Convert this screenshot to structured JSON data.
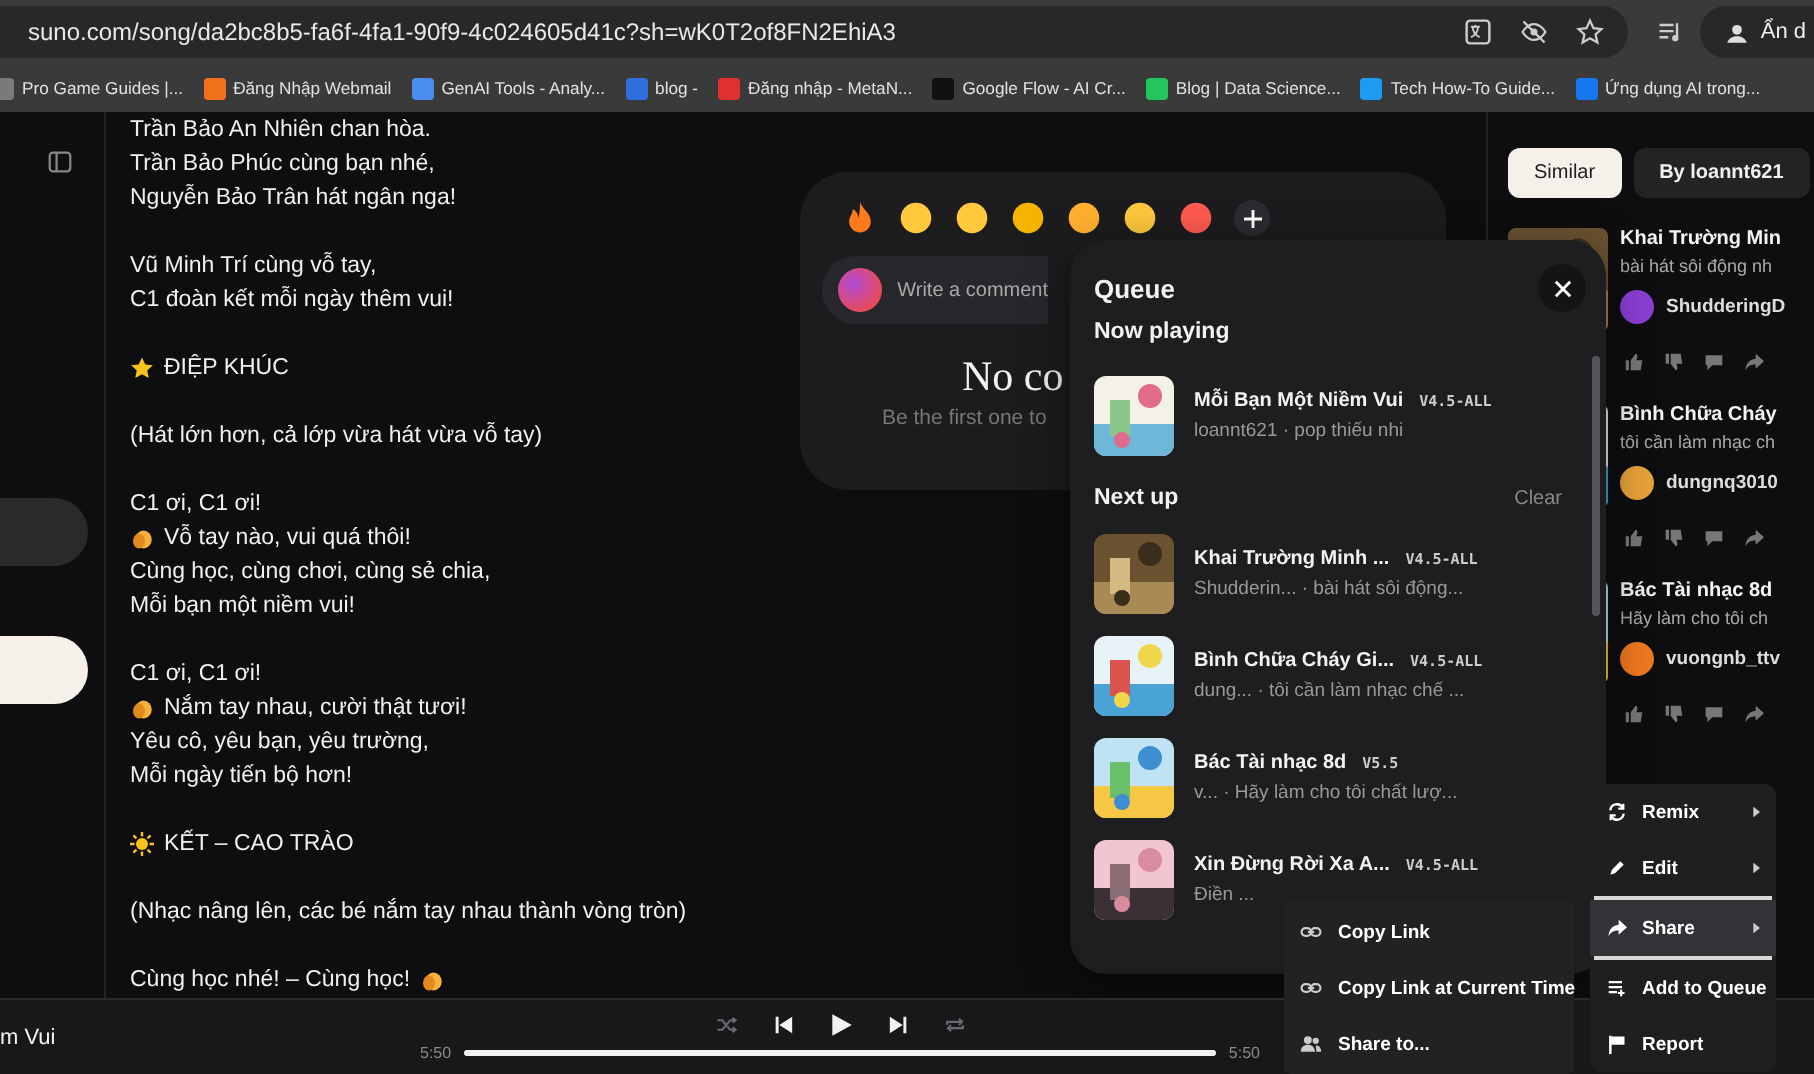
{
  "browser": {
    "url": "suno.com/song/da2bc8b5-fa6f-4fa1-90f9-4c024605d41c?sh=wK0T2of8FN2EhiA3",
    "profile": "Ẩn d"
  },
  "bookmarks": [
    {
      "label": "Pro Game Guides |...",
      "color": "#7a7a7a"
    },
    {
      "label": "Đăng Nhập Webmail",
      "color": "#f2711c"
    },
    {
      "label": "GenAI Tools - Analy...",
      "color": "#4a8df0"
    },
    {
      "label": "blog -",
      "color": "#2f6fe0"
    },
    {
      "label": "Đăng nhập - MetaN...",
      "color": "#e03131"
    },
    {
      "label": "Google Flow - AI Cr...",
      "color": "#111111"
    },
    {
      "label": "Blog | Data Science...",
      "color": "#22c55e"
    },
    {
      "label": "Tech How-To Guide...",
      "color": "#1d9bf0"
    },
    {
      "label": "Ứng dụng AI trong...",
      "color": "#1877f2"
    }
  ],
  "lyrics": [
    [
      {
        "text": "Trần Bảo An Nhiên chan hòa.",
        "kind": "plain"
      },
      {
        "text": "Trần Bảo Phúc cùng bạn nhé,",
        "kind": "plain"
      },
      {
        "text": "Nguyễn Bảo Trân hát ngân nga!",
        "kind": "plain"
      }
    ],
    [
      {
        "text": "Vũ Minh Trí cùng vỗ tay,",
        "kind": "plain"
      },
      {
        "text": "C1 đoàn kết mỗi ngày thêm vui!",
        "kind": "plain"
      }
    ],
    [
      {
        "text": "ĐIỆP KHÚC",
        "kind": "star"
      }
    ],
    [
      {
        "text": "(Hát lớn hơn, cả lớp vừa hát vừa vỗ tay)",
        "kind": "plain"
      }
    ],
    [
      {
        "text": "C1 ơi, C1 ơi!",
        "kind": "plain"
      },
      {
        "text": "Vỗ tay nào, vui quá thôi!",
        "kind": "clap"
      },
      {
        "text": "Cùng học, cùng chơi, cùng sẻ chia,",
        "kind": "plain"
      },
      {
        "text": "Mỗi bạn một niềm vui!",
        "kind": "plain"
      }
    ],
    [
      {
        "text": "C1 ơi, C1 ơi!",
        "kind": "plain"
      },
      {
        "text": "Nắm tay nhau, cười thật tươi!",
        "kind": "clap"
      },
      {
        "text": "Yêu cô, yêu bạn, yêu trường,",
        "kind": "plain"
      },
      {
        "text": "Mỗi ngày tiến bộ hơn!",
        "kind": "plain"
      }
    ],
    [
      {
        "text": "KẾT – CAO TRÀO",
        "kind": "sun"
      }
    ],
    [
      {
        "text": "(Nhạc nâng lên, các bé nắm tay nhau thành vòng tròn)",
        "kind": "plain"
      }
    ],
    [
      {
        "text": "Cùng học nhé! – Cùng học!",
        "kind": "clap-after"
      }
    ]
  ],
  "comments": {
    "placeholder": "Write a comment",
    "empty_title": "No co",
    "empty_hint": "Be the first one to"
  },
  "tabs": [
    {
      "label": "Similar",
      "selected": true
    },
    {
      "label": "By loannt621",
      "selected": false
    }
  ],
  "similar": [
    {
      "title": "Khai Trường Min",
      "description": "bài hát sôi động nh",
      "author": "ShudderingD",
      "color": "#8b3fd6"
    },
    {
      "title": "Bình Chữa Cháy",
      "description": "tôi cần làm nhạc ch",
      "author": "dungnq3010",
      "color": "#e8a33a"
    },
    {
      "title": "Bác Tài nhạc 8d",
      "description": "Hãy làm cho tôi ch",
      "author": "vuongnb_ttv",
      "color": "#f07a1e"
    }
  ],
  "queue": {
    "title": "Queue",
    "now_playing_label": "Now playing",
    "now_playing": {
      "title": "Mỗi Bạn Một Niềm Vui",
      "version": "V4.5-ALL",
      "subtitle": "loannt621 · pop thiếu nhi"
    },
    "next_up_label": "Next up",
    "clear": "Clear",
    "next_up": [
      {
        "title": "Khai Trường Minh ...",
        "version": "V4.5-ALL",
        "subtitle": "Shudderin... · bài hát sôi động..."
      },
      {
        "title": "Bình Chữa Cháy Gi...",
        "version": "V4.5-ALL",
        "subtitle": "dung... · tôi cần làm nhạc chế ..."
      },
      {
        "title": "Bác Tài nhạc 8d",
        "version": "V5.5",
        "subtitle": "v... · Hãy làm cho tôi chất lượ..."
      },
      {
        "title": "Xin Đừng Rời Xa A...",
        "version": "V4.5-ALL",
        "subtitle": "Điền ..."
      }
    ]
  },
  "context_menu": [
    {
      "label": "Remix",
      "kind": "remix",
      "submenu": true,
      "selected": false
    },
    {
      "label": "Edit",
      "kind": "edit",
      "submenu": true,
      "selected": false
    },
    {
      "label": "Share",
      "kind": "share",
      "submenu": true,
      "selected": true
    },
    {
      "label": "Add to Queue",
      "kind": "queue",
      "submenu": false,
      "selected": false
    },
    {
      "label": "Report",
      "kind": "report",
      "submenu": false,
      "selected": false
    }
  ],
  "share_menu": [
    {
      "label": "Copy Link",
      "kind": "link"
    },
    {
      "label": "Copy Link at Current Time",
      "kind": "link"
    },
    {
      "label": "Share to...",
      "kind": "people"
    }
  ],
  "player": {
    "title": "m Vui",
    "elapsed": "5:50",
    "duration": "5:50",
    "level": 1,
    "shuffle": false,
    "repeat": false
  }
}
